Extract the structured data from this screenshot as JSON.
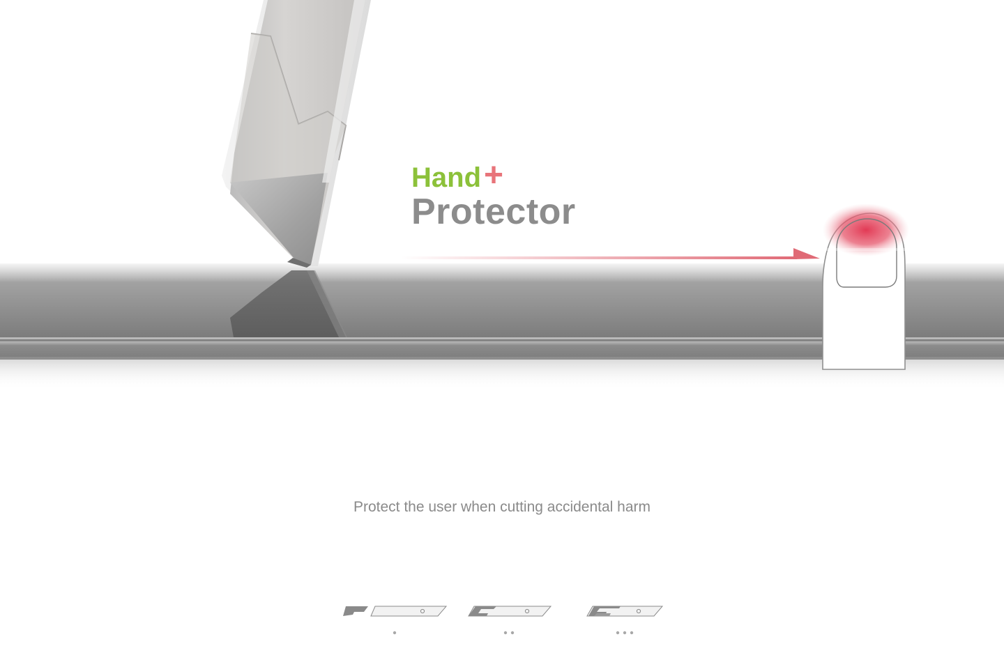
{
  "title": {
    "word1": "Hand",
    "plus": "+",
    "word2": "Protector"
  },
  "caption": "Protect the user when cutting accidental harm",
  "steps": [
    {
      "label": "•",
      "dot_count": 1
    },
    {
      "label": "••",
      "dot_count": 2
    },
    {
      "label": "•••",
      "dot_count": 3
    }
  ],
  "colors": {
    "green": "#8cc13a",
    "red": "#e8747a",
    "gray_text": "#8c8c8c",
    "caption_text": "#8a8a8a",
    "bar": "#8f8f8f",
    "arrow": "#e06a76",
    "fingertip": "#e23a55"
  },
  "icons": {
    "blade": "cutter-blade-icon",
    "finger": "finger-icon",
    "arrow": "arrow-right-icon"
  }
}
